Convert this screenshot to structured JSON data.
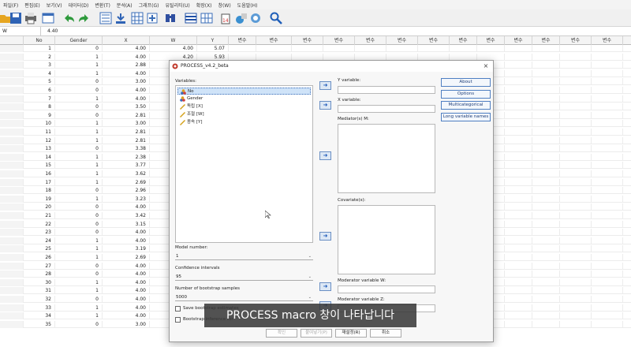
{
  "menu": [
    "파일(F)",
    "편집(E)",
    "보기(V)",
    "데이터(D)",
    "변환(T)",
    "분석(A)",
    "그래프(G)",
    "유틸리티(U)",
    "확장(X)",
    "창(W)",
    "도움말(H)"
  ],
  "cell": {
    "ref": "W",
    "value": "4.40"
  },
  "columns": [
    "No",
    "Gender",
    "X",
    "W",
    "Y",
    "변수",
    "변수",
    "변수",
    "변수",
    "변수",
    "변수",
    "변수",
    "변수",
    "변수",
    "변수",
    "변수",
    "변수",
    "변수",
    "변수",
    "변수",
    "변수",
    "변수",
    "변수",
    "변수"
  ],
  "rows": [
    {
      "n": "1",
      "g": "0",
      "x": "4.00",
      "w": "4.00",
      "y": "5.07"
    },
    {
      "n": "2",
      "g": "1",
      "x": "4.00",
      "w": "4.20",
      "y": "5.93"
    },
    {
      "n": "3",
      "g": "1",
      "x": "2.88"
    },
    {
      "n": "4",
      "g": "1",
      "x": "4.00"
    },
    {
      "n": "5",
      "g": "0",
      "x": "3.00"
    },
    {
      "n": "6",
      "g": "0",
      "x": "4.00"
    },
    {
      "n": "7",
      "g": "1",
      "x": "4.00"
    },
    {
      "n": "8",
      "g": "0",
      "x": "3.50"
    },
    {
      "n": "9",
      "g": "0",
      "x": "2.81"
    },
    {
      "n": "10",
      "g": "1",
      "x": "3.00"
    },
    {
      "n": "11",
      "g": "1",
      "x": "2.81"
    },
    {
      "n": "12",
      "g": "1",
      "x": "2.81"
    },
    {
      "n": "13",
      "g": "0",
      "x": "3.38"
    },
    {
      "n": "14",
      "g": "1",
      "x": "2.38"
    },
    {
      "n": "15",
      "g": "1",
      "x": "3.77"
    },
    {
      "n": "16",
      "g": "1",
      "x": "3.62"
    },
    {
      "n": "17",
      "g": "1",
      "x": "2.69"
    },
    {
      "n": "18",
      "g": "0",
      "x": "2.96"
    },
    {
      "n": "19",
      "g": "1",
      "x": "3.23"
    },
    {
      "n": "20",
      "g": "0",
      "x": "4.00"
    },
    {
      "n": "21",
      "g": "0",
      "x": "3.42"
    },
    {
      "n": "22",
      "g": "0",
      "x": "3.15"
    },
    {
      "n": "23",
      "g": "0",
      "x": "4.00"
    },
    {
      "n": "24",
      "g": "1",
      "x": "4.00"
    },
    {
      "n": "25",
      "g": "1",
      "x": "3.19"
    },
    {
      "n": "26",
      "g": "1",
      "x": "2.69"
    },
    {
      "n": "27",
      "g": "0",
      "x": "4.00"
    },
    {
      "n": "28",
      "g": "0",
      "x": "4.00"
    },
    {
      "n": "30",
      "g": "1",
      "x": "4.00"
    },
    {
      "n": "31",
      "g": "1",
      "x": "4.00"
    },
    {
      "n": "32",
      "g": "0",
      "x": "4.00"
    },
    {
      "n": "33",
      "g": "1",
      "x": "4.00"
    },
    {
      "n": "34",
      "g": "1",
      "x": "4.00"
    },
    {
      "n": "35",
      "g": "0",
      "x": "3.00"
    }
  ],
  "dialog": {
    "title": "PROCESS_v4.2_beta",
    "close": "×",
    "variables_label": "Variables:",
    "variables": [
      {
        "name": "No",
        "icon": "nominal-icon"
      },
      {
        "name": "Gender",
        "icon": "nominal-icon"
      },
      {
        "name": "독립 [X]",
        "icon": "scale-icon"
      },
      {
        "name": "조절 [W]",
        "icon": "scale-icon"
      },
      {
        "name": "종속 [Y]",
        "icon": "scale-icon"
      }
    ],
    "y_label": "Y variable:",
    "x_label": "X variable:",
    "mediator_label": "Mediator(s) M:",
    "covariate_label": "Covariate(s):",
    "modw_label": "Moderator variable W:",
    "modz_label": "Moderator variable Z:",
    "model_label": "Model number:",
    "model_value": "1",
    "ci_label": "Confidence intervals",
    "ci_value": "95",
    "boot_label": "Number of bootstrap samples",
    "boot_value": "5000",
    "save_boot": "Save bootstrap estimates",
    "boot_inf": "Bootstrap inference for",
    "side_buttons": [
      "About",
      "Options",
      "Multicategorical",
      "Long variable names"
    ],
    "bottom_buttons": [
      "확인",
      "붙여넣기(P)",
      "재설정(R)",
      "취소"
    ],
    "arrow": "➜"
  },
  "subtitle": "PROCESS macro 창이 나타납니다"
}
